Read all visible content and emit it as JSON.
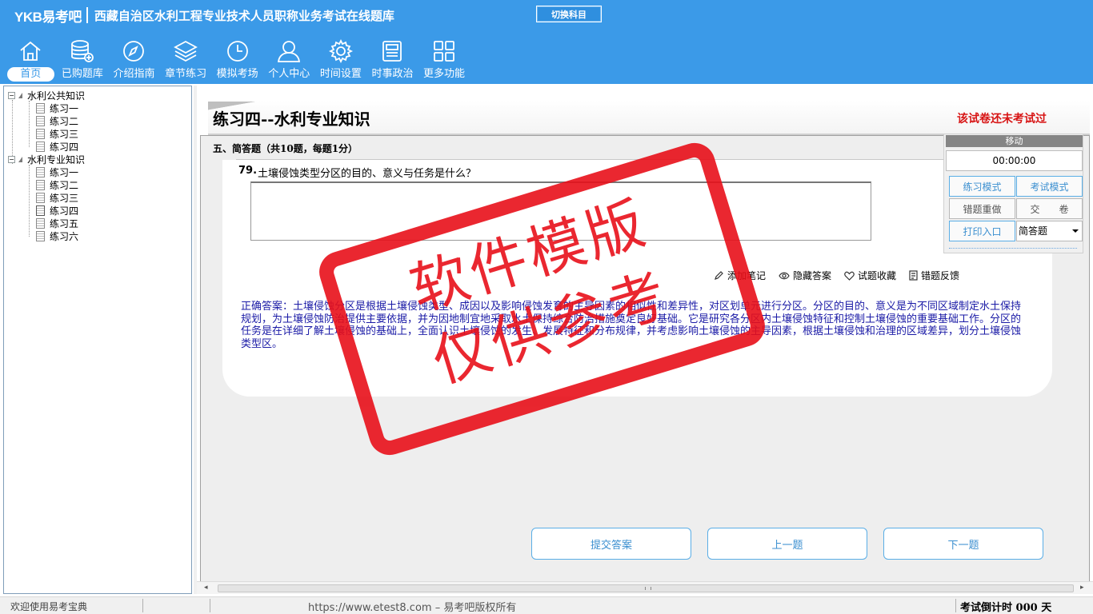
{
  "header": {
    "logo": "YKB易考吧",
    "title": "西藏自治区水利工程专业技术人员职称业务考试在线题库",
    "switch_subject": "切换科目"
  },
  "nav": [
    {
      "label": "首页",
      "icon": "home-icon"
    },
    {
      "label": "已购题库",
      "icon": "database-add-icon"
    },
    {
      "label": "介绍指南",
      "icon": "compass-icon"
    },
    {
      "label": "章节练习",
      "icon": "layers-icon"
    },
    {
      "label": "模拟考场",
      "icon": "clock-icon"
    },
    {
      "label": "个人中心",
      "icon": "user-icon"
    },
    {
      "label": "时间设置",
      "icon": "gear-icon"
    },
    {
      "label": "时事政治",
      "icon": "newspaper-icon"
    },
    {
      "label": "更多功能",
      "icon": "grid-icon"
    }
  ],
  "tree": {
    "groups": [
      {
        "label": "水利公共知识",
        "items": [
          "练习一",
          "练习二",
          "练习三",
          "练习四"
        ]
      },
      {
        "label": "水利专业知识",
        "items": [
          "练习一",
          "练习二",
          "练习三",
          "练习四",
          "练习五",
          "练习六"
        ]
      }
    ]
  },
  "main": {
    "title": "练习四--水利专业知识",
    "exam_status": "该试卷还未考试过",
    "section_heading": "五、简答题（共10题，每题1分）",
    "question_number": "79.",
    "question_text": "土壤侵蚀类型分区的目的、意义与任务是什么？",
    "tools": [
      "添加笔记",
      "隐藏答案",
      "试题收藏",
      "错题反馈"
    ],
    "correct_answer": "正确答案：土壤侵蚀分区是根据土壤侵蚀类型、成因以及影响侵蚀发育的主导因素的相似性和差异性，对区划单元进行分区。分区的目的、意义是为不同区域制定水土保持规划，为土壤侵蚀防治提供主要依据，并为因地制宜地采取水土保持综合防治措施奠定良好基础。它是研究各分区内土壤侵蚀特征和控制土壤侵蚀的重要基础工作。分区的任务是在详细了解土壤侵蚀的基础上，全面认识土壤侵蚀的发生、发展特征和分布规律，并考虑影响土壤侵蚀的主导因素，根据土壤侵蚀和治理的区域差异，划分土壤侵蚀类型区。",
    "buttons": {
      "submit": "提交答案",
      "prev": "上一题",
      "next": "下一题"
    }
  },
  "control_panel": {
    "move": "移动",
    "timer": "00:00:00",
    "practice_mode": "练习模式",
    "exam_mode": "考试模式",
    "redo_wrong": "错题重做",
    "submit_paper": "交　　卷",
    "print": "打印入口",
    "question_type": "简答题"
  },
  "stamp": {
    "line1": "软件模版",
    "line2": "仅供参考"
  },
  "statusbar": {
    "welcome": "欢迎使用易考宝典",
    "copyright": "https://www.etest8.com – 易考吧版权所有",
    "countdown": "考试倒计时 000 天"
  },
  "colors": {
    "header": "#3b9ae8",
    "status_red": "#d71313",
    "answer_blue": "#1a1aa6",
    "stamp_red": "#e8101a"
  }
}
